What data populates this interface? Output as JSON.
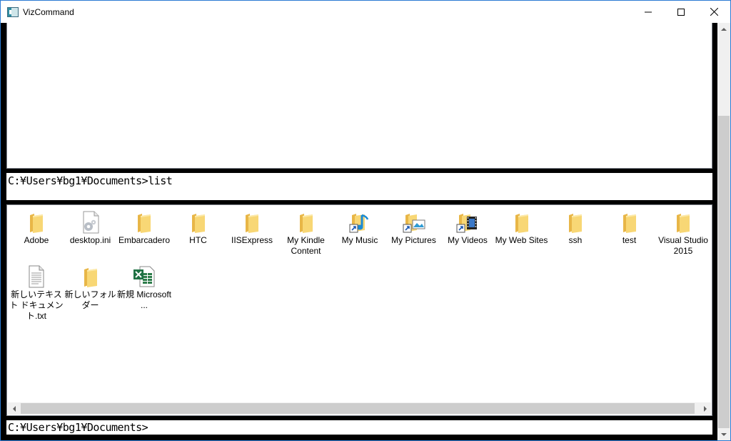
{
  "window": {
    "title": "VizCommand",
    "icon": "vizcommand-app-icon",
    "controls": [
      "minimize-icon",
      "maximize-icon",
      "close-icon"
    ]
  },
  "command_line_1": "C:¥Users¥bg1¥Documents>list",
  "command_line_2": "C:¥Users¥bg1¥Documents>",
  "files": [
    {
      "name": "Adobe",
      "icon": "folder-icon"
    },
    {
      "name": "desktop.ini",
      "icon": "settings-file-icon"
    },
    {
      "name": "Embarcadero",
      "icon": "folder-icon"
    },
    {
      "name": "HTC",
      "icon": "folder-icon"
    },
    {
      "name": "IISExpress",
      "icon": "folder-icon"
    },
    {
      "name": "My Kindle Content",
      "icon": "folder-icon"
    },
    {
      "name": "My Music",
      "icon": "music-shortcut-icon"
    },
    {
      "name": "My Pictures",
      "icon": "pictures-shortcut-icon"
    },
    {
      "name": "My Videos",
      "icon": "videos-shortcut-icon"
    },
    {
      "name": "My Web Sites",
      "icon": "folder-icon"
    },
    {
      "name": "ssh",
      "icon": "folder-icon"
    },
    {
      "name": "test",
      "icon": "folder-icon"
    },
    {
      "name": "Visual Studio 2015",
      "icon": "folder-icon"
    },
    {
      "name": "新しいテキスト ドキュメント.txt",
      "icon": "text-file-icon"
    },
    {
      "name": "新しいフォルダー",
      "icon": "folder-icon"
    },
    {
      "name": "新規 Microsoft ...",
      "icon": "excel-file-icon"
    }
  ],
  "colors": {
    "window_border": "#2b7bd4",
    "folder": "#f8d775",
    "folder_dark": "#e8b647",
    "scrollbar_track": "#f0f0f0",
    "scrollbar_thumb": "#cdcdcd"
  }
}
